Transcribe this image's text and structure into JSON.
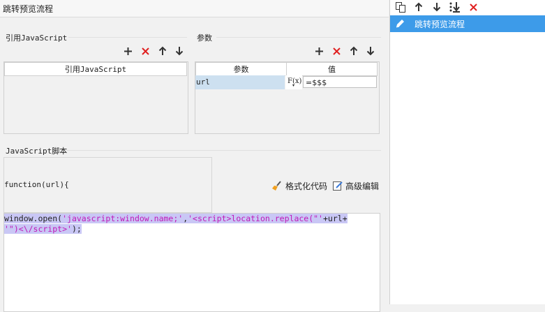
{
  "title": "跳转预览流程",
  "ref_js": {
    "label": "引用JavaScript",
    "column_header": "引用JavaScript"
  },
  "params": {
    "label": "参数",
    "columns": [
      "参数",
      "值"
    ],
    "rows": [
      {
        "name": "url",
        "formula_btn": "F(x)",
        "value": "=$$$"
      }
    ]
  },
  "script": {
    "label": "JavaScript脚本",
    "signature": "function(url){",
    "format_label": "格式化代码",
    "advanced_label": "高级编辑",
    "code": {
      "l1_a": "window.open(",
      "l1_s1": "'javascript:window.name;'",
      "l1_b": ",",
      "l1_s2": "'<script>location.replace(\"'",
      "l1_c": "+url+",
      "l2_s": "'\")<\\/script>'",
      "l2_b": ");"
    }
  },
  "sidebar": {
    "items": [
      {
        "label": "跳转预览流程",
        "icon": "pencil-icon",
        "selected": true
      }
    ]
  },
  "colors": {
    "accent": "#3d9be9",
    "add": "#333333",
    "delete": "#e02020",
    "selection": "#c9c7f5",
    "string": "#c018b8"
  }
}
